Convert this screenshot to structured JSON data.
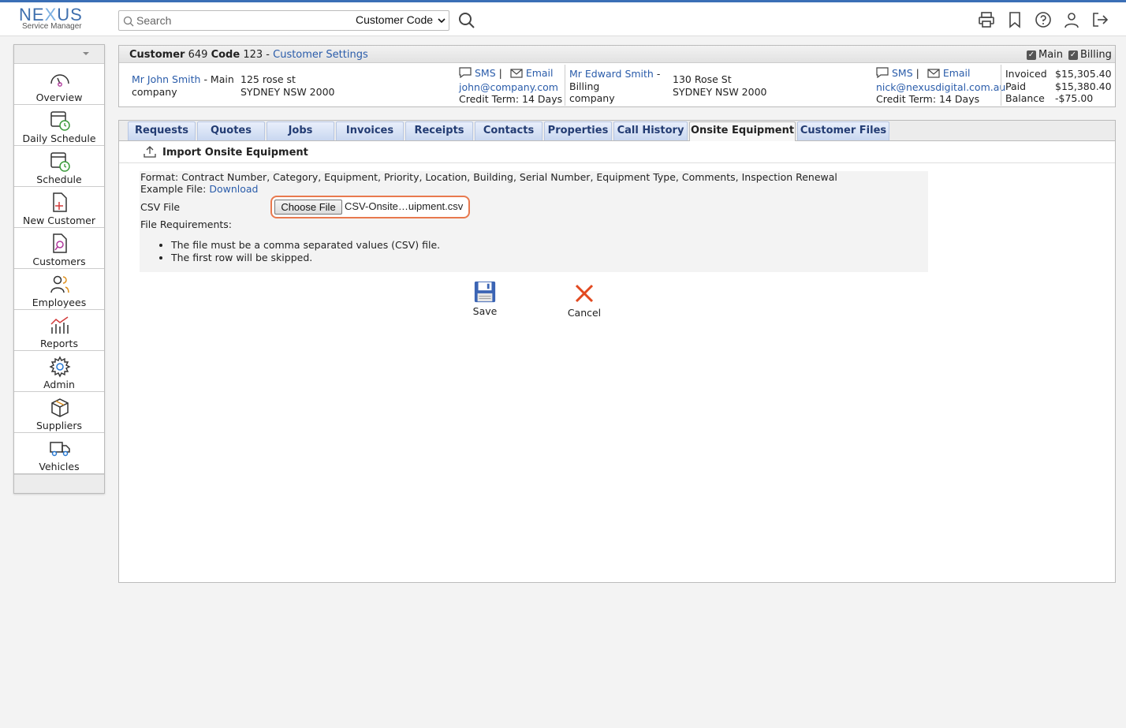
{
  "brand": {
    "name": "NEXUS",
    "tagline": "Service Manager"
  },
  "search": {
    "placeholder": "Search",
    "mode": "Customer Code"
  },
  "top_icons": [
    "printer-icon",
    "bookmark-icon",
    "help-icon",
    "user-icon",
    "logout-icon"
  ],
  "sidebar": {
    "items": [
      {
        "label": "Overview",
        "icon": "gauge-icon"
      },
      {
        "label": "Daily Schedule",
        "icon": "calendar-clock-icon"
      },
      {
        "label": "Schedule",
        "icon": "calendar-clock-icon"
      },
      {
        "label": "New Customer",
        "icon": "file-plus-icon"
      },
      {
        "label": "Customers",
        "icon": "file-search-icon"
      },
      {
        "label": "Employees",
        "icon": "users-icon"
      },
      {
        "label": "Reports",
        "icon": "chart-icon"
      },
      {
        "label": "Admin",
        "icon": "gear-icon"
      },
      {
        "label": "Suppliers",
        "icon": "box-icon"
      },
      {
        "label": "Vehicles",
        "icon": "truck-icon"
      }
    ]
  },
  "customer": {
    "customer_label": "Customer",
    "customer_num": "649",
    "code_label": "Code",
    "code_num": "123",
    "dash": "-",
    "settings_link": "Customer Settings",
    "main_check": "Main",
    "billing_check": "Billing",
    "contact1": {
      "name": "Mr John Smith",
      "role_suffix": "- Main",
      "company": "company",
      "addr1": "125 rose st",
      "addr2": "SYDNEY NSW 2000",
      "sms": "SMS",
      "pipe": "|",
      "email": "Email",
      "email_addr": "john@company.com",
      "credit": "Credit Term: 14 Days"
    },
    "contact2": {
      "name": "Mr Edward Smith",
      "role_suffix": "-",
      "role": "Billing",
      "company": "company",
      "addr1": "130 Rose St",
      "addr2": "SYDNEY NSW 2000",
      "sms": "SMS",
      "pipe": "|",
      "email": "Email",
      "email_addr": "nick@nexusdigital.com.au",
      "credit": "Credit Term: 14 Days"
    },
    "totals": {
      "invoiced_label": "Invoiced",
      "invoiced": "$15,305.40",
      "paid_label": "Paid",
      "paid": "$15,380.40",
      "balance_label": "Balance",
      "balance": "-$75.00"
    }
  },
  "tabs": [
    "Requests",
    "Quotes",
    "Jobs",
    "Invoices",
    "Receipts",
    "Contacts",
    "Properties",
    "Call History",
    "Onsite Equipment",
    "Customer Files"
  ],
  "active_tab": "Onsite Equipment",
  "import": {
    "title": "Import Onsite Equipment",
    "format": "Format: Contract Number, Category, Equipment, Priority, Location, Building, Serial Number, Equipment Type, Comments, Inspection Renewal",
    "example_label": "Example File:",
    "example_link": "Download",
    "csv_label": "CSV File",
    "choose_button": "Choose File",
    "file_name": "CSV-Onsite…uipment.csv",
    "requirements_label": "File Requirements:",
    "requirements": [
      "The file must be a comma separated values (CSV) file.",
      "The first row will be skipped."
    ],
    "save": "Save",
    "cancel": "Cancel"
  }
}
